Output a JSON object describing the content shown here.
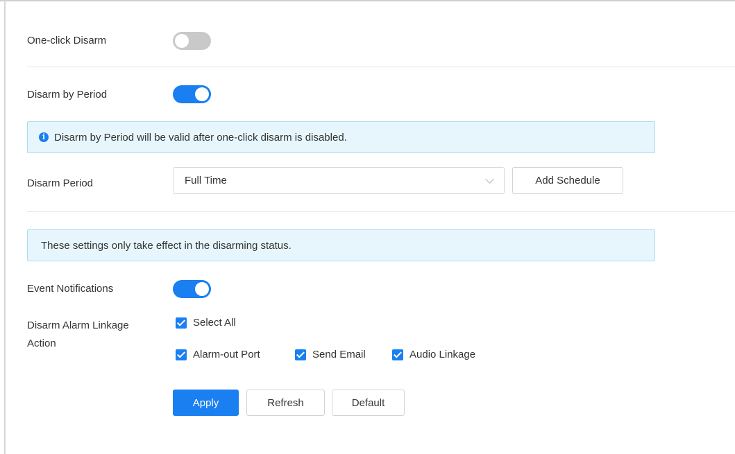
{
  "colors": {
    "accent": "#1a7ff0",
    "toggle_off": "#c9c9c9",
    "info_bg": "#e6f6fc",
    "info_border": "#a9dcef"
  },
  "one_click_disarm": {
    "label": "One-click Disarm",
    "enabled": false
  },
  "disarm_by_period": {
    "label": "Disarm by Period",
    "enabled": true,
    "notice": "Disarm by Period will be valid after one-click disarm is disabled.",
    "notice_icon": "info-icon"
  },
  "disarm_period": {
    "label": "Disarm Period",
    "selected": "Full Time",
    "add_schedule_label": "Add Schedule"
  },
  "disarming_notice": "These settings only take effect in the disarming status.",
  "event_notifications": {
    "label": "Event Notifications",
    "enabled": true
  },
  "linkage": {
    "label_line1": "Disarm Alarm Linkage",
    "label_line2": "Action",
    "select_all": {
      "label": "Select All",
      "checked": true
    },
    "options": [
      {
        "label": "Alarm-out Port",
        "checked": true
      },
      {
        "label": "Send Email",
        "checked": true
      },
      {
        "label": "Audio Linkage",
        "checked": true
      }
    ]
  },
  "actions": {
    "apply": "Apply",
    "refresh": "Refresh",
    "default": "Default"
  }
}
